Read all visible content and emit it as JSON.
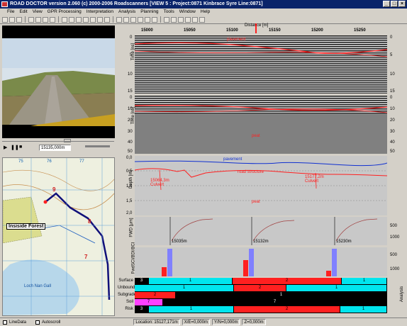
{
  "window": {
    "title": "ROAD DOCTOR version 2.060 (c) 2000-2006 Roadscanners  [VIEW 5 : Project:0871 Kinbrace Syre  Line:0871]"
  },
  "menu": [
    "File",
    "Edit",
    "View",
    "GPR Processing",
    "Interpretation",
    "Analysis",
    "Planning",
    "Tools",
    "Window",
    "Help"
  ],
  "distance": {
    "label": "Distance [m]",
    "ticks": [
      "15000",
      "15050",
      "15100",
      "15150",
      "15200",
      "15250"
    ]
  },
  "video": {
    "position": "15135,000m"
  },
  "map": {
    "label": "Insiside Forest",
    "grid_numbers": [
      "75",
      "76",
      "77",
      "9",
      "8",
      "7"
    ],
    "place_labels": [
      "Loch Nan Gall"
    ]
  },
  "gpr1": {
    "ylabel": "Time [ns]",
    "ticks_left": [
      "0",
      "5",
      "10",
      "15"
    ],
    "ticks_right": [
      "0",
      "5",
      "10",
      "15"
    ],
    "layer": "pavement"
  },
  "gpr2": {
    "ylabel": "Time [ns]",
    "ticks_left": [
      "0",
      "10",
      "20",
      "30",
      "40",
      "50"
    ],
    "ticks_right": [
      "0",
      "10",
      "20",
      "30",
      "40",
      "50"
    ],
    "layer": "peat"
  },
  "depth": {
    "ylabel": "Depth [m]",
    "ticks": [
      "0,0",
      "0,5",
      "1,0",
      "1,5",
      "2,0"
    ],
    "labels": [
      "pavement",
      "road structure",
      "peat"
    ],
    "annotations": [
      "15064,3m Culvert",
      "15177,2m Culvert"
    ]
  },
  "fwd": {
    "ylabel": "FWD [μm]",
    "ticks": [
      "500",
      "1000"
    ],
    "points": [
      "15035m",
      "15132m",
      "15230m"
    ]
  },
  "bars": {
    "ylabel": "FwdSCI/BDI/BCI",
    "ticks": [
      "500",
      "1000"
    ]
  },
  "lanes": {
    "names": [
      "Surface",
      "Unbound",
      "Subgrade",
      "Soil",
      "Risk"
    ],
    "surface": [
      "3",
      "1",
      "2",
      "1"
    ],
    "unbound": [
      "1",
      "2",
      "1"
    ],
    "subgrade": [
      "2",
      "1"
    ],
    "soil": [
      "7",
      "7"
    ],
    "risk": [
      "3",
      "1",
      "2",
      "1"
    ]
  },
  "status": {
    "linedata": "LineData",
    "autoscroll": "Autoscroll",
    "location": "Location: 15127,171m",
    "x": "X/E=0,000m",
    "y": "Y/N=0,000m",
    "z": "Z=0,000m"
  },
  "side_label": "Analysis",
  "colors": {
    "titlebar": "#0a246a",
    "cyan": "#00e5ee",
    "red": "#ff2020",
    "black": "#000000"
  }
}
